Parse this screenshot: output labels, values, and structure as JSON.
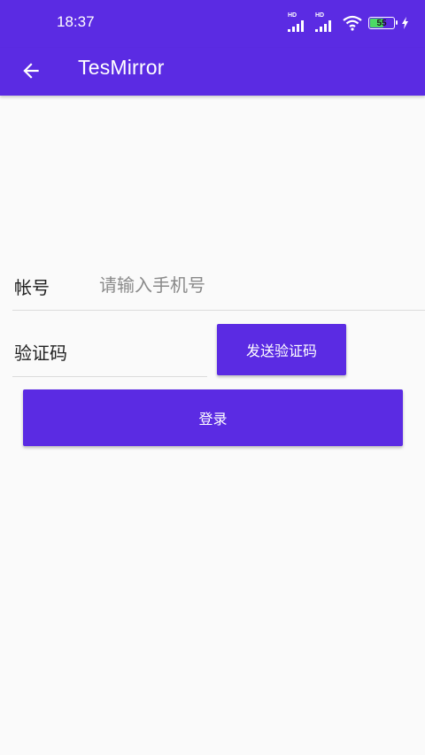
{
  "status_bar": {
    "time": "18:37",
    "signal_1_label": "HD",
    "signal_2_label": "HD",
    "battery_level": "55",
    "icons": [
      "signal-icon",
      "signal-icon",
      "wifi-icon",
      "battery-icon",
      "charging-icon"
    ]
  },
  "app_bar": {
    "title": "TesMirror",
    "back_icon": "arrow-back-icon"
  },
  "form": {
    "account_label": "帐号",
    "account_placeholder": "请输入手机号",
    "account_value": "",
    "code_label": "验证码",
    "code_value": "",
    "send_code_label": "发送验证码",
    "login_label": "登录"
  },
  "colors": {
    "primary": "#5b2be3",
    "background": "#fafafa",
    "text": "#222222",
    "hint": "#8a8a8a"
  }
}
